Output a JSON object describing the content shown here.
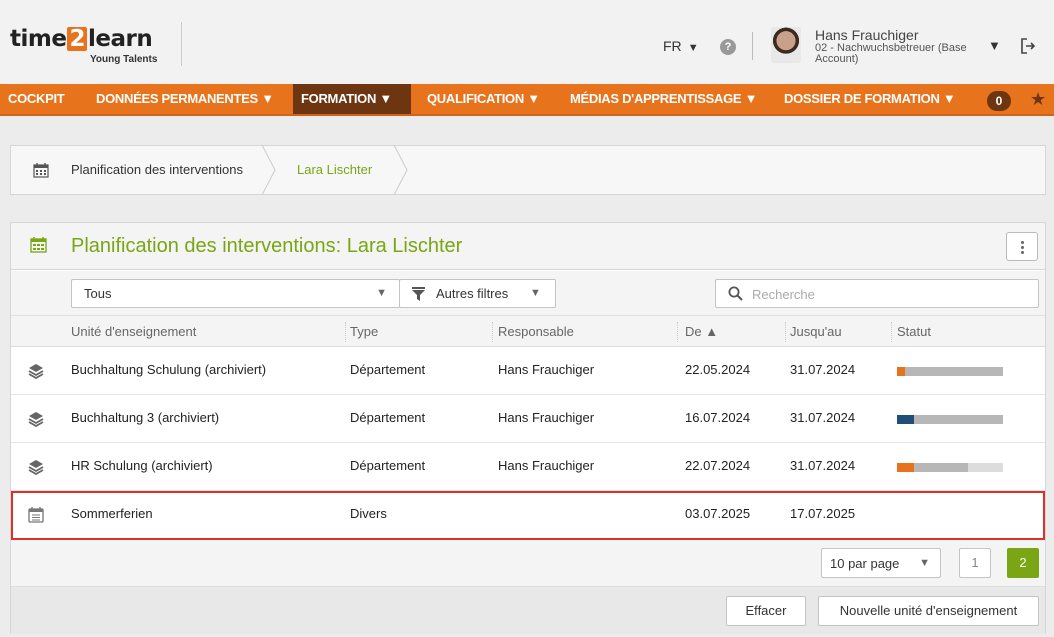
{
  "header": {
    "logo_pre": "time",
    "logo_num": "2",
    "logo_post": "learn",
    "logo_sub": "Young Talents",
    "language": "FR",
    "help_icon": "question-circle-icon",
    "user_name": "Hans Frauchiger",
    "user_role": "02 - Nachwuchsbetreuer (Base Account)"
  },
  "nav": {
    "items": [
      {
        "label": "COCKPIT"
      },
      {
        "label": "DONNÉES PERMANENTES ▼"
      },
      {
        "label": "FORMATION ▼"
      },
      {
        "label": "QUALIFICATION ▼"
      },
      {
        "label": "MÉDIAS D'APPRENTISSAGE ▼"
      },
      {
        "label": "DOSSIER DE FORMATION ▼"
      }
    ],
    "active_index": 2,
    "badge": "0"
  },
  "breadcrumb": {
    "items": [
      "Planification des interventions",
      "Lara Lischter"
    ]
  },
  "panel": {
    "title": "Planification des interventions: Lara Lischter"
  },
  "filters": {
    "select_value": "Tous",
    "more_filters": "Autres filtres",
    "search_placeholder": "Recherche"
  },
  "table": {
    "columns": [
      "Unité d'enseignement",
      "Type",
      "Responsable",
      "De ▲",
      "Jusqu'au",
      "Statut"
    ],
    "rows": [
      {
        "icon": "layers-icon",
        "unit": "Buchhaltung Schulung (archiviert)",
        "type": "Département",
        "responsible": "Hans Frauchiger",
        "from": "22.05.2024",
        "to": "31.07.2024",
        "status": [
          {
            "color": "#e8731d",
            "fraction": 0.08
          },
          {
            "color": "#b7b7b7",
            "fraction": 0.92
          }
        ]
      },
      {
        "icon": "layers-icon",
        "unit": "Buchhaltung 3 (archiviert)",
        "type": "Département",
        "responsible": "Hans Frauchiger",
        "from": "16.07.2024",
        "to": "31.07.2024",
        "status": [
          {
            "color": "#1f4e79",
            "fraction": 0.16
          },
          {
            "color": "#b7b7b7",
            "fraction": 0.84
          }
        ]
      },
      {
        "icon": "layers-icon",
        "unit": "HR Schulung (archiviert)",
        "type": "Département",
        "responsible": "Hans Frauchiger",
        "from": "22.07.2024",
        "to": "31.07.2024",
        "status": [
          {
            "color": "#e8731d",
            "fraction": 0.16
          },
          {
            "color": "#b7b7b7",
            "fraction": 0.51
          },
          {
            "color": "#dcdcdc",
            "fraction": 0.33
          }
        ]
      },
      {
        "icon": "calendar-icon",
        "unit": "Sommerferien",
        "type": "Divers",
        "responsible": "",
        "from": "03.07.2025",
        "to": "17.07.2025",
        "status": []
      }
    ]
  },
  "pager": {
    "per_page": "10 par page",
    "pages": [
      "1",
      "2"
    ],
    "current": "2"
  },
  "footer": {
    "clear_label": "Effacer",
    "new_label": "Nouvelle unité d'enseignement"
  }
}
